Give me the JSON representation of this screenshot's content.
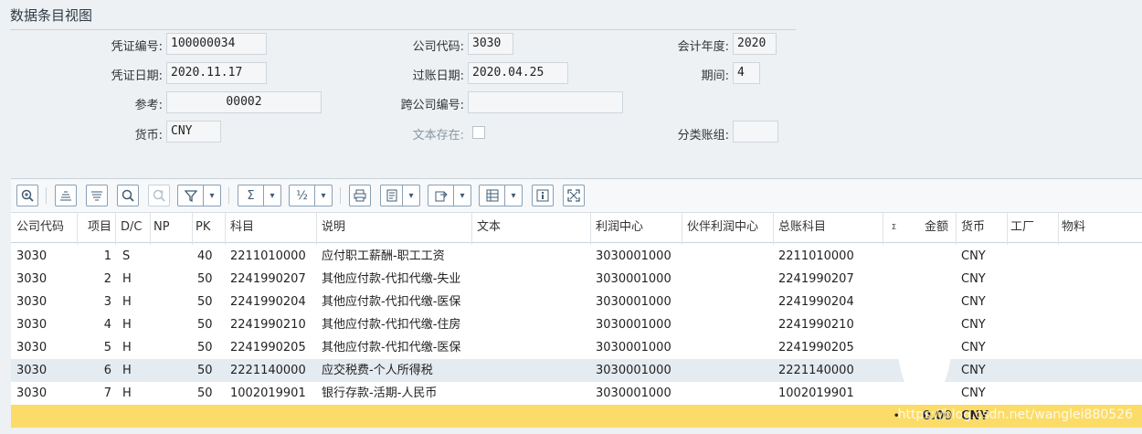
{
  "header": {
    "title": "数据条目视图"
  },
  "form": {
    "voucher_no_label": "凭证编号:",
    "voucher_no": "100000034",
    "company_label": "公司代码:",
    "company": "3030",
    "fiscal_year_label": "会计年度:",
    "fiscal_year": "2020",
    "voucher_date_label": "凭证日期:",
    "voucher_date": "2020.11.17",
    "posting_date_label": "过账日期:",
    "posting_date": "2020.04.25",
    "period_label": "期间:",
    "period": "4",
    "reference_label": "参考:",
    "reference": "00002",
    "cross_company_label": "跨公司编号:",
    "cross_company": "",
    "currency_label": "货币:",
    "currency": "CNY",
    "text_exists_label": "文本存在:",
    "ledger_group_label": "分类账组:",
    "ledger_group": ""
  },
  "toolbar": {
    "icons": [
      "zoom-details-icon",
      "sort-ascending-icon",
      "sort-descending-icon",
      "find-icon",
      "find-next-icon",
      "filter-icon",
      "sum-icon",
      "subtotal-icon",
      "print-icon",
      "view-icon",
      "export-icon",
      "layout-icon",
      "info-icon",
      "fullscreen-icon"
    ],
    "sum_glyph": "Σ",
    "subtotal_glyph": "½"
  },
  "table": {
    "columns": [
      "公司代码",
      "项目",
      "D/C",
      "NP",
      "PK",
      "科目",
      "说明",
      "文本",
      "利润中心",
      "伙伴利润中心",
      "总账科目",
      "金额",
      "货币",
      "工厂",
      "物料"
    ],
    "amount_sigma": "Σ",
    "rows": [
      {
        "company": "3030",
        "item": "1",
        "dc": "S",
        "np": "",
        "pk": "40",
        "account": "2211010000",
        "desc": "应付职工薪酬-职工工资",
        "text": "",
        "profit_center": "3030001000",
        "partner_pc": "",
        "gl": "2211010000",
        "amount": "",
        "currency": "CNY"
      },
      {
        "company": "3030",
        "item": "2",
        "dc": "H",
        "np": "",
        "pk": "50",
        "account": "2241990207",
        "desc": "其他应付款-代扣代缴-失业",
        "text": "",
        "profit_center": "3030001000",
        "partner_pc": "",
        "gl": "2241990207",
        "amount": "",
        "currency": "CNY"
      },
      {
        "company": "3030",
        "item": "3",
        "dc": "H",
        "np": "",
        "pk": "50",
        "account": "2241990204",
        "desc": "其他应付款-代扣代缴-医保",
        "text": "",
        "profit_center": "3030001000",
        "partner_pc": "",
        "gl": "2241990204",
        "amount": "",
        "currency": "CNY"
      },
      {
        "company": "3030",
        "item": "4",
        "dc": "H",
        "np": "",
        "pk": "50",
        "account": "2241990210",
        "desc": "其他应付款-代扣代缴-住房",
        "text": "",
        "profit_center": "3030001000",
        "partner_pc": "",
        "gl": "2241990210",
        "amount": "",
        "currency": "CNY"
      },
      {
        "company": "3030",
        "item": "5",
        "dc": "H",
        "np": "",
        "pk": "50",
        "account": "2241990205",
        "desc": "其他应付款-代扣代缴-医保",
        "text": "",
        "profit_center": "3030001000",
        "partner_pc": "",
        "gl": "2241990205",
        "amount": "",
        "currency": "CNY"
      },
      {
        "company": "3030",
        "item": "6",
        "dc": "H",
        "np": "",
        "pk": "50",
        "account": "2221140000",
        "desc": "应交税费-个人所得税",
        "text": "",
        "profit_center": "3030001000",
        "partner_pc": "",
        "gl": "2221140000",
        "amount": "",
        "currency": "CNY"
      },
      {
        "company": "3030",
        "item": "7",
        "dc": "H",
        "np": "",
        "pk": "50",
        "account": "1002019901",
        "desc": "银行存款-活期-人民币",
        "text": "",
        "profit_center": "3030001000",
        "partner_pc": "",
        "gl": "1002019901",
        "amount": "",
        "currency": "CNY"
      }
    ],
    "total": {
      "bullet": "•",
      "amount": "0.00",
      "currency": "CNY"
    }
  },
  "watermark": "https://blog.csdn.net/wanglei880526",
  "colors": {
    "total_row": "#fcdc68",
    "selected_row": "#e4ebf1",
    "icon_blue": "#3f5c76"
  }
}
